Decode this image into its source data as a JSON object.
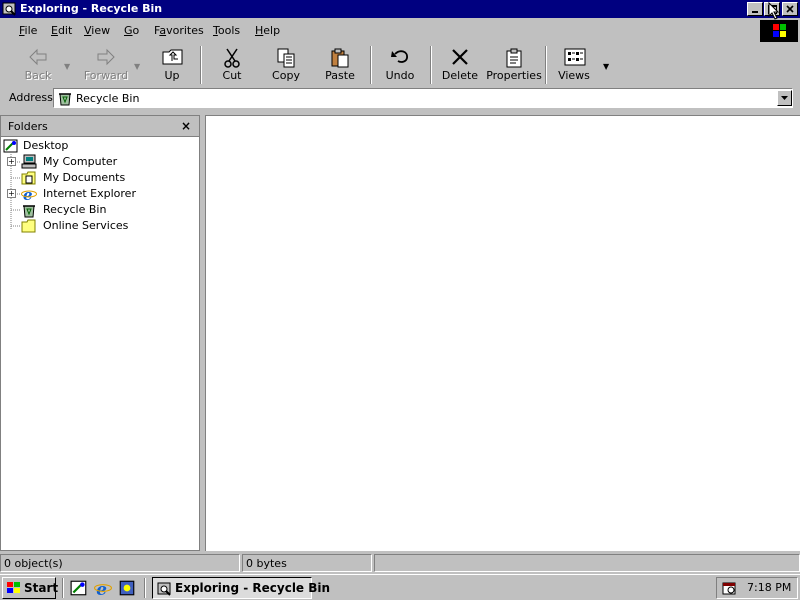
{
  "window": {
    "title": "Exploring - Recycle Bin",
    "title_bar_color": "#000080",
    "controls": [
      "minimize-icon",
      "maximize-icon",
      "close-icon"
    ]
  },
  "menu": {
    "items": [
      {
        "label": "File",
        "accel": "F"
      },
      {
        "label": "Edit",
        "accel": "E"
      },
      {
        "label": "View",
        "accel": "V"
      },
      {
        "label": "Go",
        "accel": "G"
      },
      {
        "label": "Favorites",
        "accel": "a"
      },
      {
        "label": "Tools",
        "accel": "T"
      },
      {
        "label": "Help",
        "accel": "H"
      }
    ]
  },
  "toolbar": {
    "back_label": "Back",
    "forward_label": "Forward",
    "up_label": "Up",
    "cut_label": "Cut",
    "copy_label": "Copy",
    "paste_label": "Paste",
    "undo_label": "Undo",
    "delete_label": "Delete",
    "properties_label": "Properties",
    "views_label": "Views"
  },
  "address": {
    "label": "Address",
    "value": "Recycle Bin",
    "icon": "recycle-bin-icon"
  },
  "folders": {
    "title": "Folders",
    "close_symbol": "×",
    "items": [
      {
        "label": "Desktop",
        "icon": "desktop-icon",
        "expander": "",
        "level": 0
      },
      {
        "label": "My Computer",
        "icon": "computer-icon",
        "expander": "+",
        "level": 1
      },
      {
        "label": "My Documents",
        "icon": "folder-icon",
        "expander": "",
        "level": 1
      },
      {
        "label": "Internet Explorer",
        "icon": "internet-explorer-icon",
        "expander": "+",
        "level": 1
      },
      {
        "label": "Recycle Bin",
        "icon": "recycle-bin-icon",
        "expander": "",
        "level": 1
      },
      {
        "label": "Online Services",
        "icon": "folder-icon",
        "expander": "",
        "level": 1
      }
    ]
  },
  "status": {
    "objects": "0 object(s)",
    "size": "0 bytes"
  },
  "taskbar": {
    "start_label": "Start",
    "task_label": "Exploring - Recycle Bin",
    "clock": "7:18 PM",
    "quick_launch": [
      "desktop-icon",
      "internet-explorer-icon",
      "channels-icon"
    ]
  }
}
